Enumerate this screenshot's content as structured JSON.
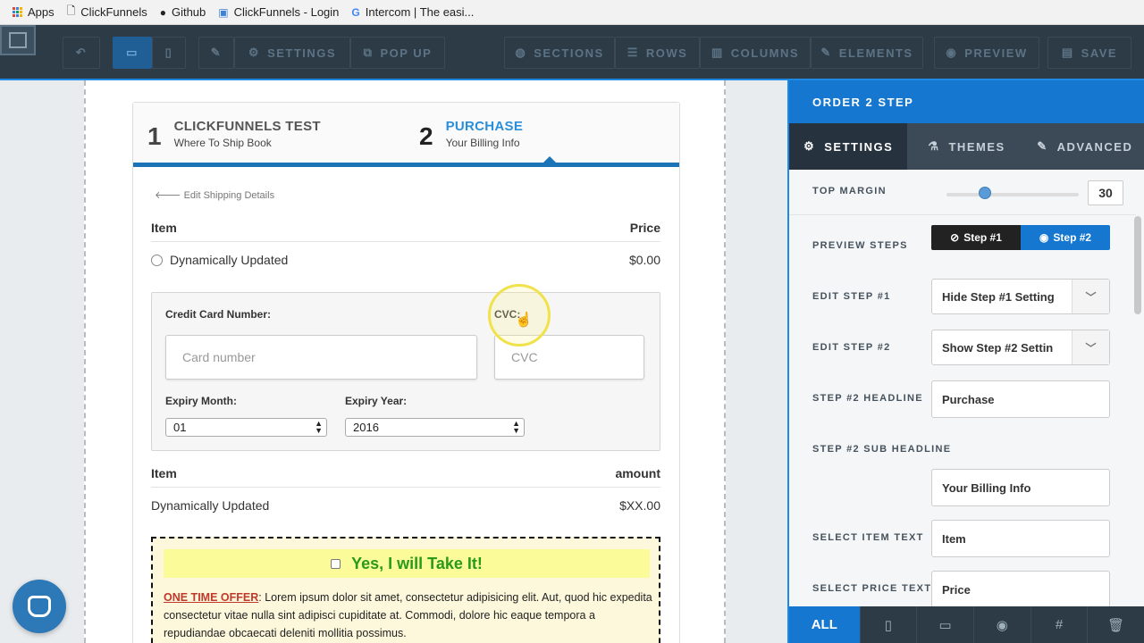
{
  "bookmarks": [
    {
      "label": "Apps",
      "icon": "apps-grid-icon"
    },
    {
      "label": "ClickFunnels",
      "icon": "page-icon"
    },
    {
      "label": "Github",
      "icon": "github-icon"
    },
    {
      "label": "ClickFunnels - Login",
      "icon": "clickfunnels-icon"
    },
    {
      "label": "Intercom | The easi...",
      "icon": "google-icon"
    }
  ],
  "toolbar": {
    "settings": "SETTINGS",
    "popup": "POP UP",
    "sections": "SECTIONS",
    "rows": "ROWS",
    "columns": "COLUMNS",
    "elements": "ELEMENTS",
    "preview": "PREVIEW",
    "save": "SAVE"
  },
  "form": {
    "step1": {
      "num": "1",
      "headline": "CLICKFUNNELS TEST",
      "sub": "Where To Ship Book"
    },
    "step2": {
      "num": "2",
      "headline": "PURCHASE",
      "sub": "Your Billing Info"
    },
    "back_link": "Edit Shipping Details",
    "table1": {
      "col_item": "Item",
      "col_price": "Price",
      "row_item": "Dynamically Updated",
      "row_price": "$0.00"
    },
    "cc": {
      "card_label": "Credit Card Number:",
      "card_placeholder": "Card number",
      "cvc_label": "CVC:",
      "cvc_placeholder": "CVC",
      "month_label": "Expiry Month:",
      "month_value": "01",
      "year_label": "Expiry Year:",
      "year_value": "2016"
    },
    "table2": {
      "col_item": "Item",
      "col_amount": "amount",
      "row_item": "Dynamically Updated",
      "row_amount": "$XX.00"
    },
    "offer": {
      "headline": "Yes, I will Take It!",
      "oto_label": "ONE TIME OFFER",
      "text": ": Lorem ipsum dolor sit amet, consectetur adipisicing elit. Aut, quod hic expedita consectetur vitae nulla sint adipisci cupiditate at. Commodi, dolore hic eaque tempora a repudiandae obcaecati deleniti mollitia possimus."
    }
  },
  "panel": {
    "title": "ORDER 2 STEP",
    "tabs": {
      "settings": "SETTINGS",
      "themes": "THEMES",
      "advanced": "ADVANCED"
    },
    "top_margin_label": "TOP MARGIN",
    "top_margin_value": "30",
    "top_margin_level": 0.3,
    "preview_steps_label": "PREVIEW STEPS",
    "preview_step1": "Step #1",
    "preview_step2": "Step #2",
    "edit_step1_label": "EDIT STEP #1",
    "edit_step1_value": "Hide Step #1 Setting",
    "edit_step2_label": "EDIT STEP #2",
    "edit_step2_value": "Show Step #2 Settin",
    "step2_headline_label": "STEP #2 HEADLINE",
    "step2_headline_value": "Purchase",
    "step2_sub_label": "STEP #2 SUB HEADLINE",
    "step2_sub_value": "Your Billing Info",
    "select_item_label": "SELECT ITEM TEXT",
    "select_item_value": "Item",
    "select_price_label": "SELECT PRICE TEXT",
    "select_price_value": "Price",
    "footer_all": "ALL"
  },
  "colors": {
    "accent": "#1577cf",
    "toolbar": "#2d3b47",
    "offer_green": "#2a9a1a",
    "oto_red": "#c0392b"
  }
}
